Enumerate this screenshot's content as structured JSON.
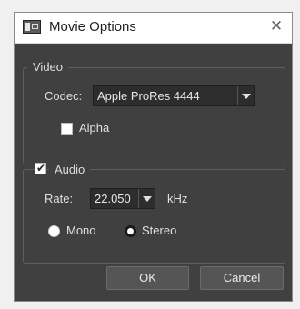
{
  "window": {
    "title": "Movie Options",
    "close_glyph": "✕",
    "icon": "movie-options-icon"
  },
  "video": {
    "group_label": "Video",
    "codec_label": "Codec:",
    "codec_value": "Apple ProRes 4444",
    "alpha_label": "Alpha",
    "alpha_checked": false
  },
  "audio": {
    "group_label": "Audio",
    "enabled": true,
    "check_glyph": "✔",
    "rate_label": "Rate:",
    "rate_value": "22.050",
    "rate_unit": "kHz",
    "mono_label": "Mono",
    "stereo_label": "Stereo",
    "selected_channel": "Stereo"
  },
  "buttons": {
    "ok_label": "OK",
    "cancel_label": "Cancel"
  },
  "colors": {
    "dialog_bg": "#404040",
    "titlebar_bg": "#ffffff",
    "button_bg": "#555555"
  }
}
